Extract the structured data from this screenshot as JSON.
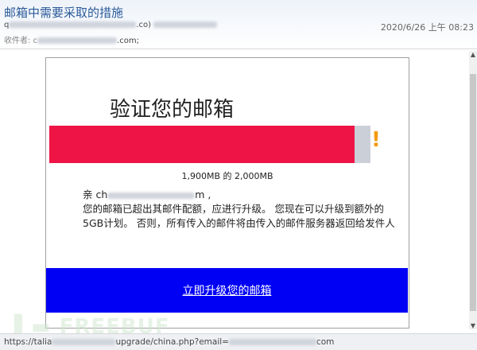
{
  "email": {
    "subject": "邮箱中需要采取的措施",
    "from_prefix": "q",
    "from_suffix": ".co)",
    "to_label": "收件者: c",
    "to_suffix": ".com;",
    "date": "2020/6/26 上午 08:23"
  },
  "card": {
    "title": "验证您的邮箱",
    "usage_percent": 95,
    "usage_text": "1,900MB 的 2,000MB",
    "warning_glyph": "!",
    "greeting_prefix": "亲 ch",
    "greeting_suffix": "m ,",
    "message": "您的邮箱已超出其邮件配额，应进行升级。 您现在可以升级到额外的5GB计划。 否则，所有传入的邮件将由传入的邮件服务器返回给发件人",
    "cta_label": "立即升级您的邮箱",
    "colors": {
      "bar": "#ef1446",
      "cta": "#0000f5",
      "warning": "#f39a0d"
    }
  },
  "status_bar": {
    "url_prefix": "https://talia",
    "url_middle": "upgrade/china.php?email=",
    "url_suffix": "com"
  },
  "watermark": "FREEBUF"
}
